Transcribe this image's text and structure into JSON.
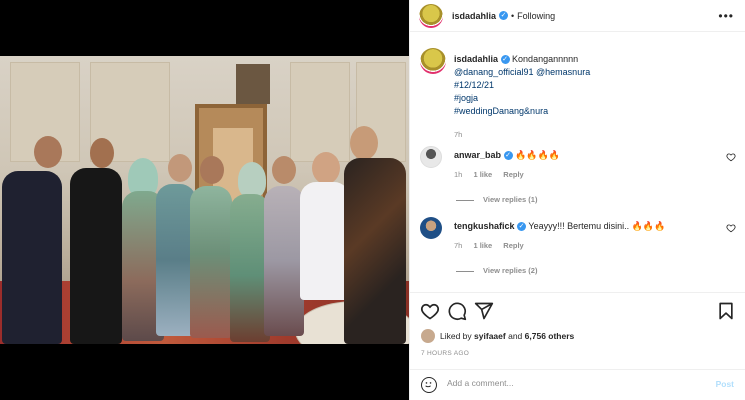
{
  "header": {
    "username": "isdadahlia",
    "verified_mark": "✓",
    "separator": "•",
    "follow_status": "Following",
    "more_label": "•••"
  },
  "caption": {
    "username": "isdadahlia",
    "verified_mark": "✓",
    "text": "Kondangannnnn",
    "lines": [
      "@danang_official91 @hemasnura",
      "#12/12/21",
      "#jogja",
      "#weddingDanang&nura"
    ],
    "time": "7h"
  },
  "comments": [
    {
      "username": "anwar_bab",
      "verified_mark": "✓",
      "text": "🔥🔥🔥🔥",
      "time": "1h",
      "likes": "1 like",
      "reply_label": "Reply",
      "view_replies": "View replies (1)"
    },
    {
      "username": "tengkushafick",
      "verified_mark": "✓",
      "text": "Yeayyy!!! Bertemu disini.. 🔥🔥🔥",
      "time": "7h",
      "likes": "1 like",
      "reply_label": "Reply",
      "view_replies": "View replies (2)"
    }
  ],
  "icons": {
    "like": "heart-icon",
    "comment": "comment-icon",
    "share": "share-icon",
    "save": "bookmark-icon"
  },
  "likes": {
    "prefix": "Liked by ",
    "user": "syifaaef",
    "middle": " and ",
    "count": "6,756 others"
  },
  "posted_time": "7 HOURS AGO",
  "add_comment": {
    "placeholder": "Add a comment...",
    "post_label": "Post"
  },
  "colors": {
    "link": "#00376b",
    "verified": "#3897f0",
    "muted": "#8e8e8e",
    "post_disabled": "#b2dffc"
  }
}
